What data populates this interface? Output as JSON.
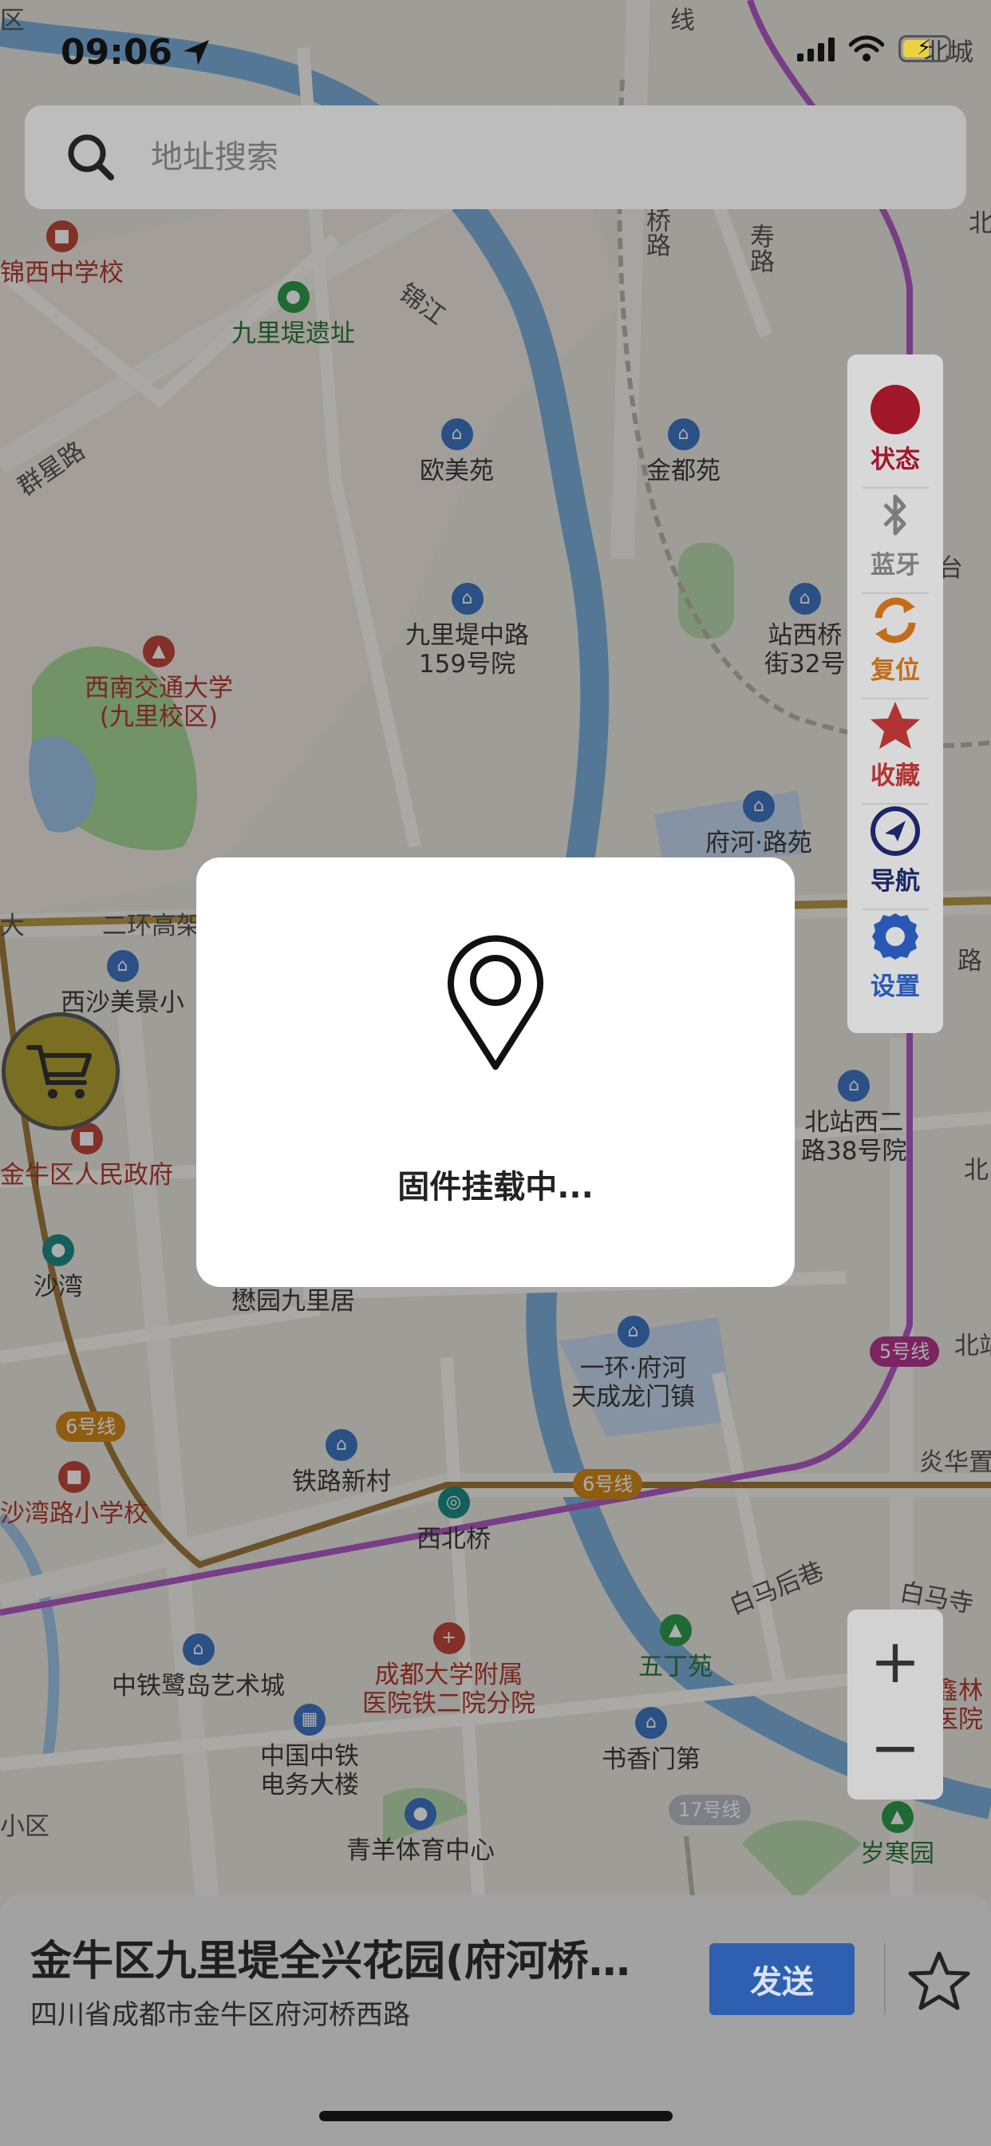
{
  "status_bar": {
    "time": "09:06"
  },
  "search": {
    "placeholder": "地址搜索"
  },
  "map_labels": {
    "pois": [
      {
        "text": "锦西中学校",
        "style": "red"
      },
      {
        "text": "九里堤遗址",
        "style": "green"
      },
      {
        "text": "欧美苑",
        "style": "blue"
      },
      {
        "text": "金都苑",
        "style": "blue"
      },
      {
        "text": "九里堤中路\n159号院",
        "style": "blue"
      },
      {
        "text": "站西桥\n街32号",
        "style": "blue"
      },
      {
        "text": "西南交通大学\n(九里校区)",
        "style": "red"
      },
      {
        "text": "府河·路苑",
        "style": "blue"
      },
      {
        "text": "西沙美景小",
        "style": "blue"
      },
      {
        "text": "金牛区人民政府",
        "style": "red"
      },
      {
        "text": "北站西二\n路38号院",
        "style": "blue"
      },
      {
        "text": "沙湾",
        "style": "teal"
      },
      {
        "text": "懋园九里居",
        "style": "plain"
      },
      {
        "text": "一环·府河\n天成龙门镇",
        "style": "blue"
      },
      {
        "text": "沙湾路小学校",
        "style": "red"
      },
      {
        "text": "铁路新村",
        "style": "blue"
      },
      {
        "text": "西北桥",
        "style": "metro"
      },
      {
        "text": "中铁鹭岛艺术城",
        "style": "blue"
      },
      {
        "text": "成都大学附属\n医院铁二院分院",
        "style": "red"
      },
      {
        "text": "五丁苑",
        "style": "green"
      },
      {
        "text": "书香门第",
        "style": "blue"
      },
      {
        "text": "中国中铁\n电务大楼",
        "style": "blue"
      },
      {
        "text": "青羊体育中心",
        "style": "blue"
      },
      {
        "text": "岁寒园",
        "style": "green"
      }
    ],
    "plain": [
      "锦江",
      "群星路",
      "二环高架",
      "白马后巷",
      "白马寺",
      "北城",
      "炎华置",
      "北站",
      "小区",
      "台",
      "路",
      "桥路",
      "寿路",
      "线",
      "区",
      "大",
      "北",
      "北",
      "鑫林\n医院"
    ],
    "metro_tags": [
      "5号线",
      "6号线",
      "6号线",
      "17号线"
    ]
  },
  "toolbar": {
    "items": [
      {
        "label": "状态",
        "icon": "status-dot-icon",
        "color": "#b01a2e"
      },
      {
        "label": "蓝牙",
        "icon": "bluetooth-icon",
        "color": "#8a8a8a"
      },
      {
        "label": "复位",
        "icon": "reset-icon",
        "color": "#d77a1f"
      },
      {
        "label": "收藏",
        "icon": "star-icon",
        "color": "#c23a3a"
      },
      {
        "label": "导航",
        "icon": "navigation-icon",
        "color": "#1d2a6e"
      },
      {
        "label": "设置",
        "icon": "gear-icon",
        "color": "#2d64c8"
      }
    ]
  },
  "zoom": {
    "in": "+",
    "out": "−"
  },
  "dialog": {
    "message": "固件挂载中..."
  },
  "place": {
    "name": "金牛区九里堤全兴花园(府河桥西路)",
    "address": "四川省成都市金牛区府河桥西路",
    "send_label": "发送"
  }
}
